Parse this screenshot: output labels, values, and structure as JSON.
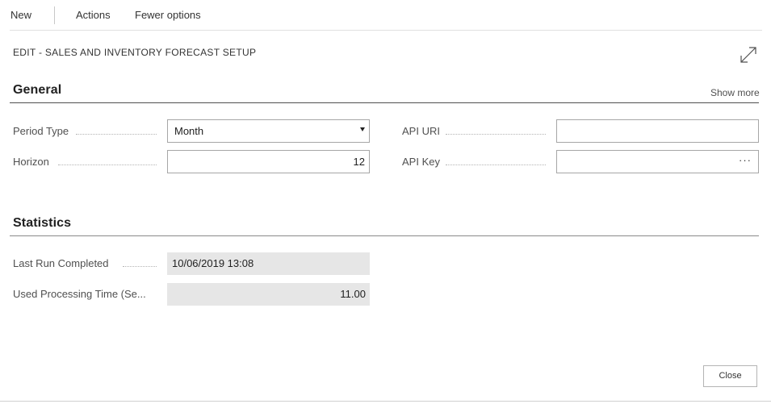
{
  "toolbar": {
    "new_label": "New",
    "actions_label": "Actions",
    "fewer_options_label": "Fewer options"
  },
  "page": {
    "title": "EDIT - SALES AND INVENTORY FORECAST SETUP"
  },
  "general": {
    "title": "General",
    "show_more": "Show more",
    "period_type": {
      "label": "Period Type",
      "value": "Month"
    },
    "horizon": {
      "label": "Horizon",
      "value": "12"
    },
    "api_uri": {
      "label": "API URI",
      "value": ""
    },
    "api_key": {
      "label": "API Key",
      "value": "",
      "action": "···"
    }
  },
  "statistics": {
    "title": "Statistics",
    "last_run_completed": {
      "label": "Last Run Completed",
      "value": "10/06/2019 13:08"
    },
    "used_processing_time": {
      "label": "Used Processing Time (Se...",
      "value": "11.00"
    }
  },
  "footer": {
    "close_label": "Close"
  },
  "icons": {
    "expand": "expand-icon",
    "dropdown": "chevron-down-icon",
    "ellipsis": "more-icon"
  }
}
